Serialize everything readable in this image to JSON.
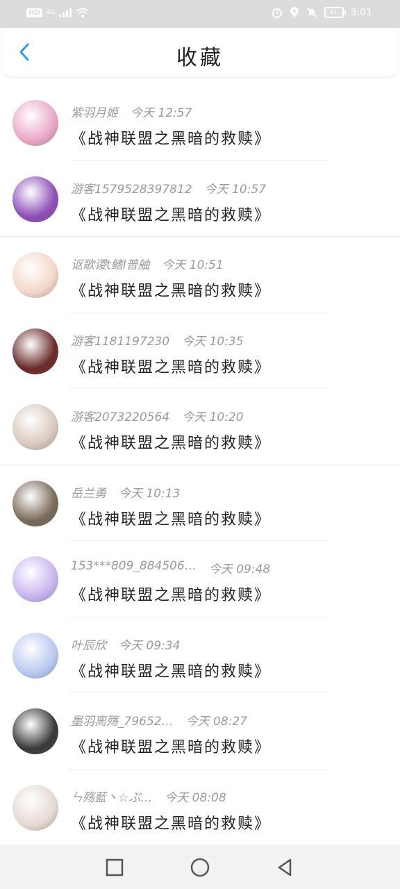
{
  "status_bar": {
    "left": [
      "HD",
      "4G"
    ],
    "battery": "61",
    "time": "3:01"
  },
  "header": {
    "title": "收藏"
  },
  "items": [
    {
      "user": "紫羽月姬",
      "time": "今天 12:57",
      "book": "《战神联盟之黑暗的救赎》",
      "avatar_color": "#e9a7c6"
    },
    {
      "user": "游客1579528397812",
      "time": "今天 10:57",
      "book": "《战神联盟之黑暗的救赎》",
      "avatar_color": "#8e4fb8"
    },
    {
      "user": "讴歌谡t鳍l普舳",
      "time": "今天 10:51",
      "book": "《战神联盟之黑暗的救赎》",
      "avatar_color": "#f3d6c9"
    },
    {
      "user": "游客1181197230",
      "time": "今天 10:35",
      "book": "《战神联盟之黑暗的救赎》",
      "avatar_color": "#6b2a2a"
    },
    {
      "user": "游客2073220564",
      "time": "今天 10:20",
      "book": "《战神联盟之黑暗的救赎》",
      "avatar_color": "#d9c9bc"
    },
    {
      "user": "岳兰勇",
      "time": "今天 10:13",
      "book": "《战神联盟之黑暗的救赎》",
      "avatar_color": "#7a6a5a"
    },
    {
      "user": "153***809_884506…",
      "time": "今天 09:48",
      "book": "《战神联盟之黑暗的救赎》",
      "avatar_color": "#c8b5ef"
    },
    {
      "user": "叶辰欣",
      "time": "今天 09:34",
      "book": "《战神联盟之黑暗的救赎》",
      "avatar_color": "#b9c8f1"
    },
    {
      "user": "墨羽离殇_79652…",
      "time": "今天 08:27",
      "book": "《战神联盟之黑暗的救赎》",
      "avatar_color": "#3a3a3a"
    },
    {
      "user": "ㄣ殇藍丶☆ぷ…",
      "time": "今天 08:08",
      "book": "《战神联盟之黑暗的救赎》",
      "avatar_color": "#e6d9d2"
    }
  ],
  "colors": {
    "accent": "#2f9be6",
    "status_bar_bg": "#dcdcdc",
    "nav_bar_bg": "#f2f2f2"
  },
  "nav": {
    "icons": [
      "square-icon",
      "circle-icon",
      "triangle-back-icon"
    ]
  }
}
